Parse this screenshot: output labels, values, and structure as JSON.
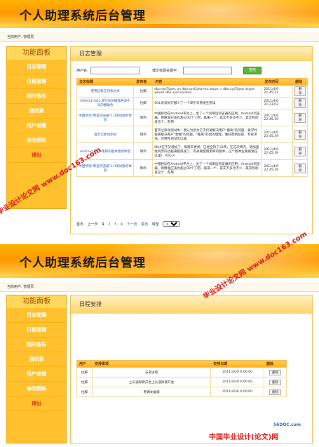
{
  "app": {
    "banner_title": "个人助理系统后台管理",
    "current_user_label": "当前用户: 管理员"
  },
  "sidebar": {
    "title": "功能面板",
    "items": [
      {
        "label": "日志管理"
      },
      {
        "label": "日程管理"
      },
      {
        "label": "临时备忘"
      },
      {
        "label": "通讯录"
      },
      {
        "label": "用户管理"
      },
      {
        "label": "修改密码"
      },
      {
        "label": "退出"
      }
    ]
  },
  "log_page": {
    "section_title": "日志管理",
    "search": {
      "user_label": "用户名:",
      "keyword_label": "博文标题关键字:",
      "button_label": "查找"
    },
    "headers": [
      "日志标题",
      "发布者",
      "内容",
      "发布时间",
      "删除"
    ],
    "rows": [
      {
        "title": "使用JS和正则表达式",
        "author": "拉脚",
        "content": "dbo.sysTypes on dbo.sysColumns.xtype = dbo.sysTypes.xtype where dbo.sysColumns...",
        "time": "2011/4/6 21:45:21",
        "action": "删除"
      },
      {
        "title": "ORACLE SQL 单引号的撤角色单引号的撤角色",
        "author": "拉脚",
        "content": "SQL语法执行撤少了一个单引号而发生错误",
        "time": "2011/4/6 21:23:02",
        "action": "删除"
      },
      {
        "title": "中国移动\"幸运浏览器\"1.0测试版初体验",
        "author": "晴鸡",
        "content": "中国移动在Android平台上，出了一个叫幸运浏览器的应用，Android浏览器，则精准应该也超过30个了吧，再来一个，其实不多也不少，其实移动发这个…有用",
        "time": "2011/4/6 22:45:39",
        "action": "删除"
      },
      {
        "title": "首页之移动测试",
        "author": "晴鸡",
        "content": "首页之移动测试中：我认为因为它不仅要解决用户\"搬离\"的问题，要学时候要解决用户\"想做\"的问题，\"搬离\"的因的理性，做好营销就变，专家评估，可用性测试可以做",
        "time": "2011/4/6 22:45:39",
        "action": "删除"
      },
      {
        "title": "Android 4.1.4用目的版本更新体验",
        "author": "晴鸡",
        "content": "MIUI在不又增加了，每周末更新，已经坚持了32周，在这次周内，增加里找到页内也越来越快速了，有关要使用用目的版本，这个版本主要跟进在这里！ http://",
        "time": "2011/4/6 22:45:39",
        "action": "删除"
      },
      {
        "title": "中国移动\"幸运浏览器\"1.0测试版初体验",
        "author": "晴鸡",
        "content": "中国移动在Android平台上，出了一个叫幸运浏览器的应用，Android浏览器，则精准应该也超过30个了吧，再来一个，其实不多也不少，其实移动发这个…有用",
        "time": "2011/4/6 22:45:39",
        "action": "删除"
      }
    ],
    "pager": {
      "first": "首页",
      "prev": "上一页",
      "pages": [
        "1",
        "2",
        "3",
        "4"
      ],
      "next": "下一页",
      "last": "尾页",
      "goto": "转至",
      "goto_value": "1"
    }
  },
  "schedule_page": {
    "section_title": "日程安排",
    "headers": [
      "用户",
      "安排事项",
      "安排日期",
      "删除"
    ],
    "rows": [
      {
        "user": "拉脚",
        "item": "去游泳吧",
        "date": "2011/4/29 0:00:00",
        "action": "删除"
      },
      {
        "user": "拉脚",
        "item": "上头通知要开会上头通知要开会",
        "date": "2011/4/29 0:00:00",
        "action": "删除"
      },
      {
        "user": "拉脚",
        "item": "看偶女幽魂",
        "date": "2011/4/26 0:00:00",
        "action": "删除"
      }
    ]
  },
  "watermarks": {
    "wm1": "毕业设计论文网 www.doc163.com",
    "wm2": "毕业设计论文网 www.doc163.com",
    "footer_logo": "56DOC.com",
    "footer_cn": "中国毕业设计(论文)网"
  }
}
